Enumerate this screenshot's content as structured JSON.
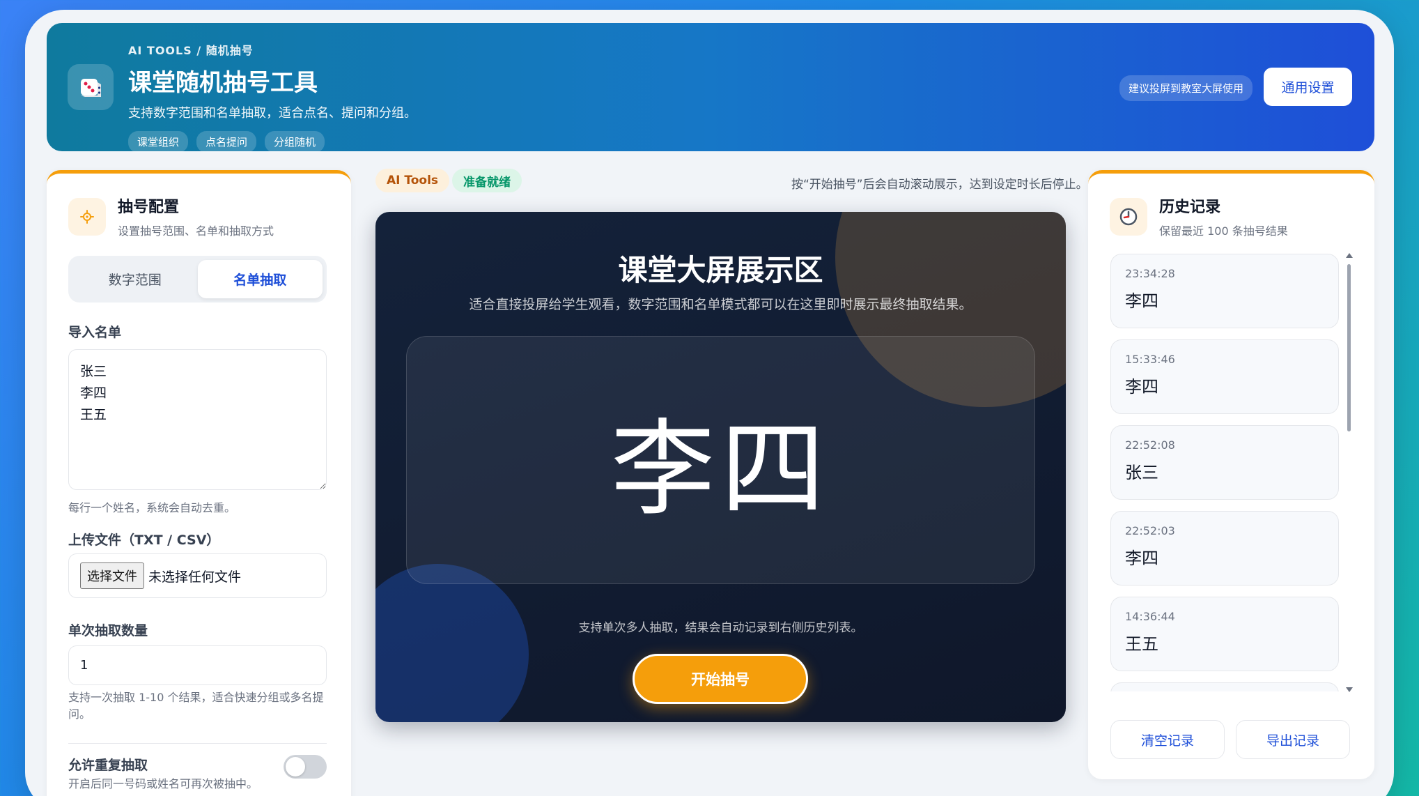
{
  "header": {
    "eyebrow": "AI TOOLS / 随机抽号",
    "title": "课堂随机抽号工具",
    "subtitle": "支持数字范围和名单抽取，适合点名、提问和分组。",
    "tags": [
      "课堂组织",
      "点名提问",
      "分组随机"
    ],
    "hint": "建议投屏到教室大屏使用",
    "settings_button": "通用设置",
    "logo_icon": "dice-icon"
  },
  "config": {
    "title": "抽号配置",
    "subtitle": "设置抽号范围、名单和抽取方式",
    "icon": "gear-icon",
    "modes": [
      "数字范围",
      "名单抽取"
    ],
    "active_mode": "名单抽取",
    "import_label": "导入名单",
    "names_value": "张三\n李四\n王五",
    "names_hint": "每行一个姓名，系统会自动去重。",
    "upload_label": "上传文件（TXT / CSV）",
    "file_button": "选择文件",
    "file_status": "未选择任何文件",
    "count_label": "单次抽取数量",
    "count_value": "1",
    "count_hint": "支持一次抽取 1-10 个结果，适合快速分组或多名提问。",
    "repeat_label": "允许重复抽取",
    "repeat_hint": "开启后同一号码或姓名可再次被抽中。",
    "repeat_enabled": false
  },
  "center": {
    "pill_ai": "AI Tools",
    "pill_status": "准备就绪",
    "hint": "按“开始抽号”后会自动滚动展示，达到设定时长后停止。",
    "stage_title": "课堂大屏展示区",
    "stage_subtitle": "适合直接投屏给学生观看，数字范围和名单模式都可以在这里即时展示最终抽取结果。",
    "result": "李四",
    "footer": "支持单次多人抽取，结果会自动记录到右侧历史列表。",
    "start_button": "开始抽号"
  },
  "history": {
    "title": "历史记录",
    "subtitle": "保留最近 100 条抽号结果",
    "icon": "clock-icon",
    "items": [
      {
        "time": "23:34:28",
        "value": "李四"
      },
      {
        "time": "15:33:46",
        "value": "李四"
      },
      {
        "time": "22:52:08",
        "value": "张三"
      },
      {
        "time": "22:52:03",
        "value": "李四"
      },
      {
        "time": "14:36:44",
        "value": "王五"
      }
    ],
    "clear_button": "清空记录",
    "export_button": "导出记录"
  },
  "colors": {
    "accent": "#f59e0b",
    "primary": "#1d4ed8",
    "stage_bg": "#0f172a"
  }
}
